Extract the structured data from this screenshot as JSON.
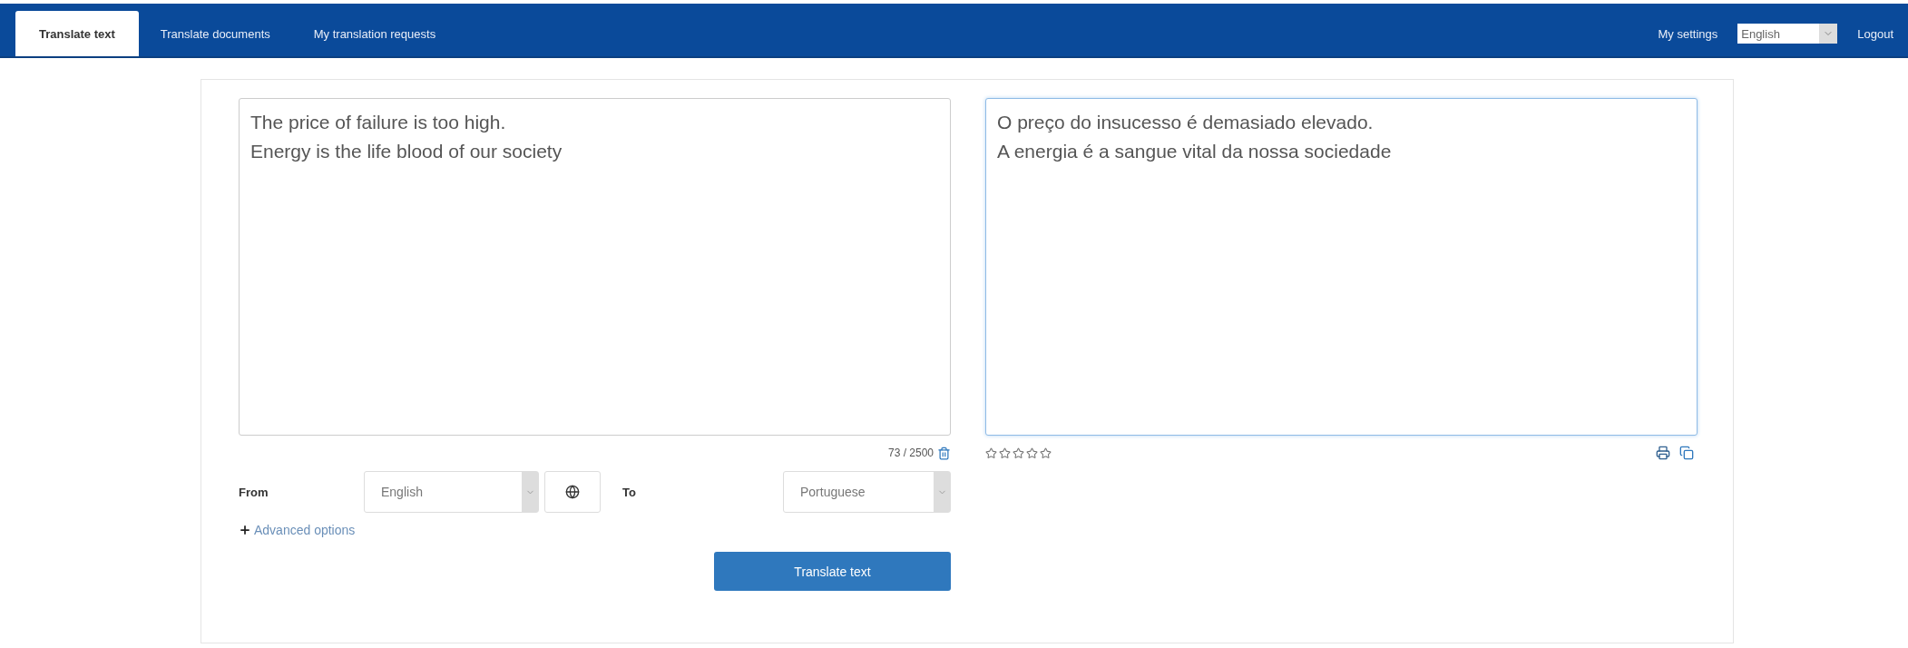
{
  "nav": {
    "tabs": [
      {
        "label": "Translate text",
        "selected": true
      },
      {
        "label": "Translate documents",
        "selected": false
      },
      {
        "label": "My translation requests",
        "selected": false
      }
    ],
    "settings": "My settings",
    "language": "English",
    "logout": "Logout"
  },
  "source": {
    "lines": [
      "The price of failure is too high.",
      "Energy is the life blood of our society"
    ],
    "counter": "73 / 2500"
  },
  "target": {
    "lines": [
      "O preço do insucesso é demasiado elevado.",
      "A energia é a sangue vital da nossa sociedade"
    ],
    "focused": true,
    "stars": 0
  },
  "controls": {
    "from_label": "From",
    "from_language": "English",
    "to_label": "To",
    "to_language": "Portuguese",
    "advanced": "Advanced options",
    "submit": "Translate text"
  }
}
